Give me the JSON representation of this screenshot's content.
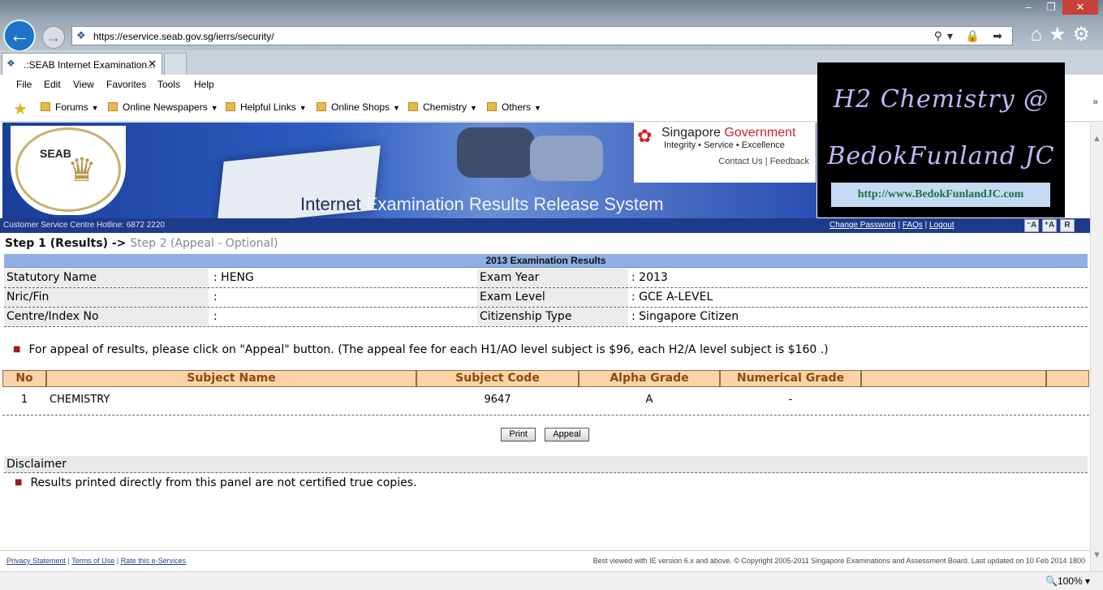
{
  "browser": {
    "url": "https://eservice.seab.gov.sg/ierrs/security/",
    "tab_title": ".:SEAB Internet Examination...",
    "menu": [
      "File",
      "Edit",
      "View",
      "Favorites",
      "Tools",
      "Help"
    ],
    "favorites": [
      "Forums",
      "Online Newspapers",
      "Helpful Links",
      "Online Shops",
      "Chemistry",
      "Others"
    ],
    "zoom": "100%"
  },
  "banner": {
    "seal_text": "SEAB",
    "system_name_dark": "Internet",
    "system_name_rest": " Examination Results Release System",
    "gov_title_a": "Singapore",
    "gov_title_b": "Government",
    "gov_motto": "Integrity • Service • Excellence",
    "contact": "Contact Us",
    "feedback": "Feedback"
  },
  "watermark": {
    "line1": "H2 Chemistry @",
    "line2": "BedokFunland JC",
    "url": "http://www.BedokFunlandJC.com"
  },
  "infobar": {
    "hotline": "Customer Service Centre Hotline: 6872 2220",
    "change_password": "Change Password",
    "faqs": "FAQs",
    "logout": "Logout",
    "font_small": "A",
    "font_large": "A",
    "reset": "R"
  },
  "steps": {
    "step1": "Step 1 (Results)",
    "arrow": " -> ",
    "step2": "Step 2 (Appeal - Optional)"
  },
  "results": {
    "title": "2013 Examination Results",
    "statutory_name_label": "Statutory Name",
    "statutory_name": ": HENG",
    "nric_label": "Nric/Fin",
    "nric": ":",
    "centre_label": "Centre/Index No",
    "centre": ":",
    "exam_year_label": "Exam Year",
    "exam_year": ": 2013",
    "exam_level_label": "Exam Level",
    "exam_level": ": GCE A-LEVEL",
    "citizenship_label": "Citizenship Type",
    "citizenship": ": Singapore Citizen"
  },
  "note": "For appeal of results, please click on \"Appeal\" button. (The appeal fee for each H1/AO level subject is $96, each H2/A level subject is $160 .)",
  "table": {
    "headers": [
      "No",
      "Subject Name",
      "Subject Code",
      "Alpha Grade",
      "Numerical Grade",
      "",
      ""
    ],
    "rows": [
      {
        "no": "1",
        "subject": "CHEMISTRY",
        "code": "9647",
        "alpha": "A",
        "numerical": "-"
      }
    ]
  },
  "buttons": {
    "print": "Print",
    "appeal": "Appeal"
  },
  "disclaimer": {
    "title": "Disclaimer",
    "text": "Results printed directly from this panel are not certified true copies."
  },
  "footer": {
    "privacy": "Privacy Statement",
    "terms": "Terms of Use",
    "rate": "Rate this e-Services",
    "copyright": "Best viewed with IE version 6.x and above. © Copyright 2005-2011 Singapore Examinations and Assessment Board. Last updated on 10 Feb 2014 1800"
  }
}
